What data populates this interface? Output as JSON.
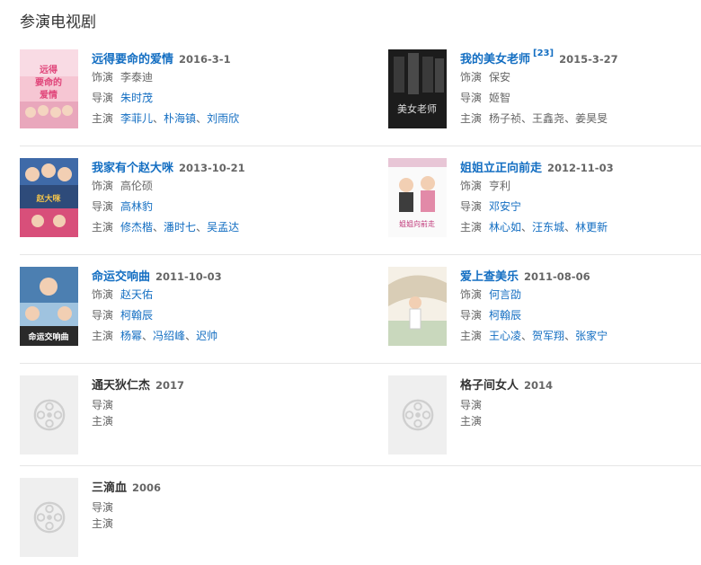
{
  "section": {
    "title": "参演电视剧"
  },
  "labels": {
    "role": "饰演",
    "director": "导演",
    "starring": "主演"
  },
  "shows": [
    {
      "title": "远得要命的爱情",
      "date": "2016-3-1",
      "role": "李泰迪",
      "director": "朱时茂",
      "cast": [
        "李菲儿",
        "朴海镇",
        "刘雨欣"
      ],
      "poster": {
        "colors": [
          "#f3b7c8",
          "#e46a98",
          "#ffffff"
        ],
        "caption": "远得要命的爱情"
      }
    },
    {
      "title": "我的美女老师",
      "cite": "[23]",
      "date": "2015-3-27",
      "role": "保安",
      "director": "姬智",
      "cast": [
        "杨子祯",
        "王鑫尧",
        "姜昊旻"
      ],
      "poster": {
        "colors": [
          "#1b1b1b",
          "#5a5a5a",
          "#cfcfcf"
        ],
        "caption": "美女老师"
      }
    },
    {
      "title": "我家有个赵大咪",
      "date": "2013-10-21",
      "role": "高伦硕",
      "director": "高林豹",
      "cast": [
        "修杰楷",
        "潘时七",
        "吴孟达"
      ],
      "poster": {
        "colors": [
          "#2e4b7a",
          "#d84f7a",
          "#f0c24b"
        ],
        "caption": "赵大咪"
      }
    },
    {
      "title": "姐姐立正向前走",
      "date": "2012-11-03",
      "role": "亨利",
      "director": "邓安宁",
      "cast": [
        "林心如",
        "汪东城",
        "林更新"
      ],
      "poster": {
        "colors": [
          "#ffffff",
          "#e8c6d6",
          "#3d3d3d"
        ],
        "caption": "姐姐向前走"
      }
    },
    {
      "title": "命运交响曲",
      "date": "2011-10-03",
      "role": "赵天佑",
      "director": "柯翰辰",
      "cast": [
        "杨幂",
        "冯绍峰",
        "迟帅"
      ],
      "poster": {
        "colors": [
          "#4c7fb1",
          "#9fc3df",
          "#2a2a2a"
        ],
        "caption": "命运交响曲"
      }
    },
    {
      "title": "爱上查美乐",
      "date": "2011-08-06",
      "role": "何言劭",
      "director": "柯翰辰",
      "cast": [
        "王心凌",
        "贺军翔",
        "张家宁"
      ],
      "poster": {
        "colors": [
          "#f5f0e6",
          "#c9b79c",
          "#6b8a5a"
        ],
        "caption": ""
      }
    },
    {
      "title": "通天狄仁杰",
      "date": "2017",
      "placeholder": true
    },
    {
      "title": "格子间女人",
      "date": "2014",
      "placeholder": true
    },
    {
      "title": "三滴血",
      "date": "2006",
      "placeholder": true
    }
  ],
  "icons": {
    "placeholder": "film-reel-icon"
  },
  "colors": {
    "link": "#136ec2",
    "divider": "#e6e6e6",
    "placeholder_bg": "#efefef"
  }
}
